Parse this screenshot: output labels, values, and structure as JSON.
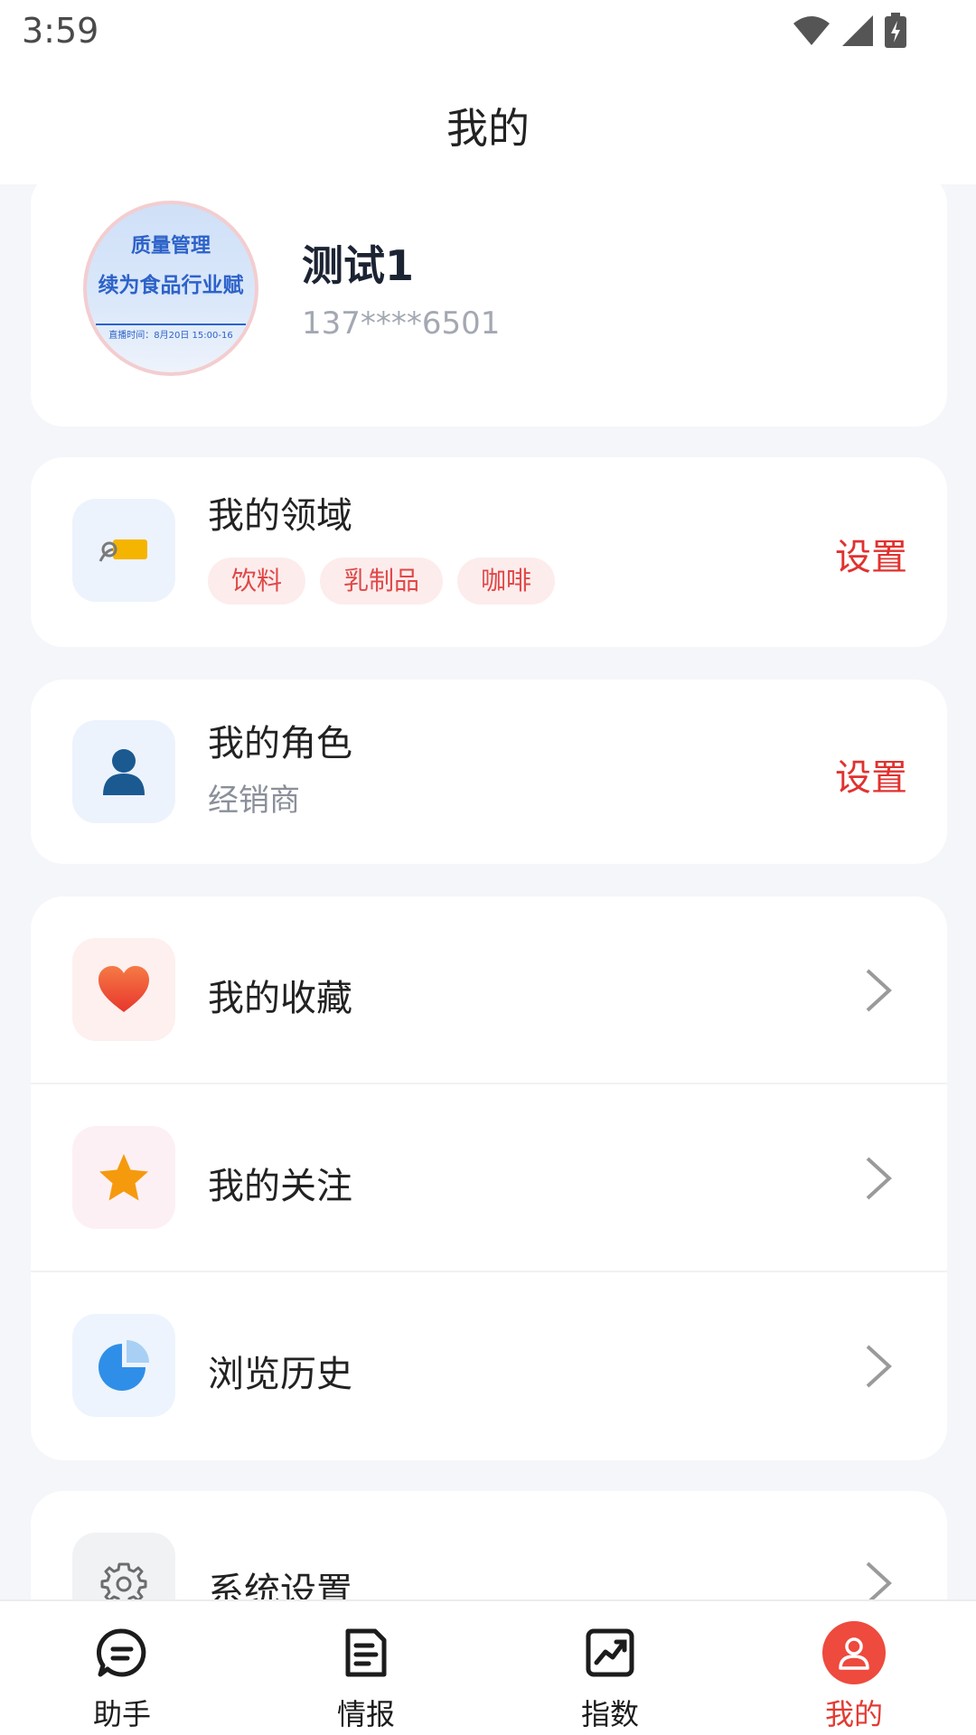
{
  "status_bar": {
    "time": "3:59"
  },
  "header": {
    "title": "我的"
  },
  "profile": {
    "name": "测试1",
    "phone": "137****6501",
    "avatar_text": {
      "line1": "质量管理",
      "line2": "续为食品行业赋",
      "line3": "直播时间：8月20日 15:00-16"
    }
  },
  "domain": {
    "title": "我的领域",
    "tags": [
      "饮料",
      "乳制品",
      "咖啡"
    ],
    "action": "设置",
    "icon": "tag-icon"
  },
  "role": {
    "title": "我的角色",
    "value": "经销商",
    "action": "设置",
    "icon": "user-icon"
  },
  "menu": {
    "items": [
      {
        "label": "我的收藏",
        "icon": "heart-icon"
      },
      {
        "label": "我的关注",
        "icon": "star-icon"
      },
      {
        "label": "浏览历史",
        "icon": "pie-chart-icon"
      }
    ]
  },
  "settings": {
    "label": "系统设置",
    "icon": "gear-icon"
  },
  "tabs": [
    {
      "label": "助手",
      "icon": "chat-icon"
    },
    {
      "label": "情报",
      "icon": "document-icon"
    },
    {
      "label": "指数",
      "icon": "trend-chart-icon"
    },
    {
      "label": "我的",
      "icon": "person-icon",
      "active": true
    }
  ],
  "colors": {
    "accent": "#e0322f",
    "background": "#f4f6fa",
    "card": "#ffffff"
  }
}
